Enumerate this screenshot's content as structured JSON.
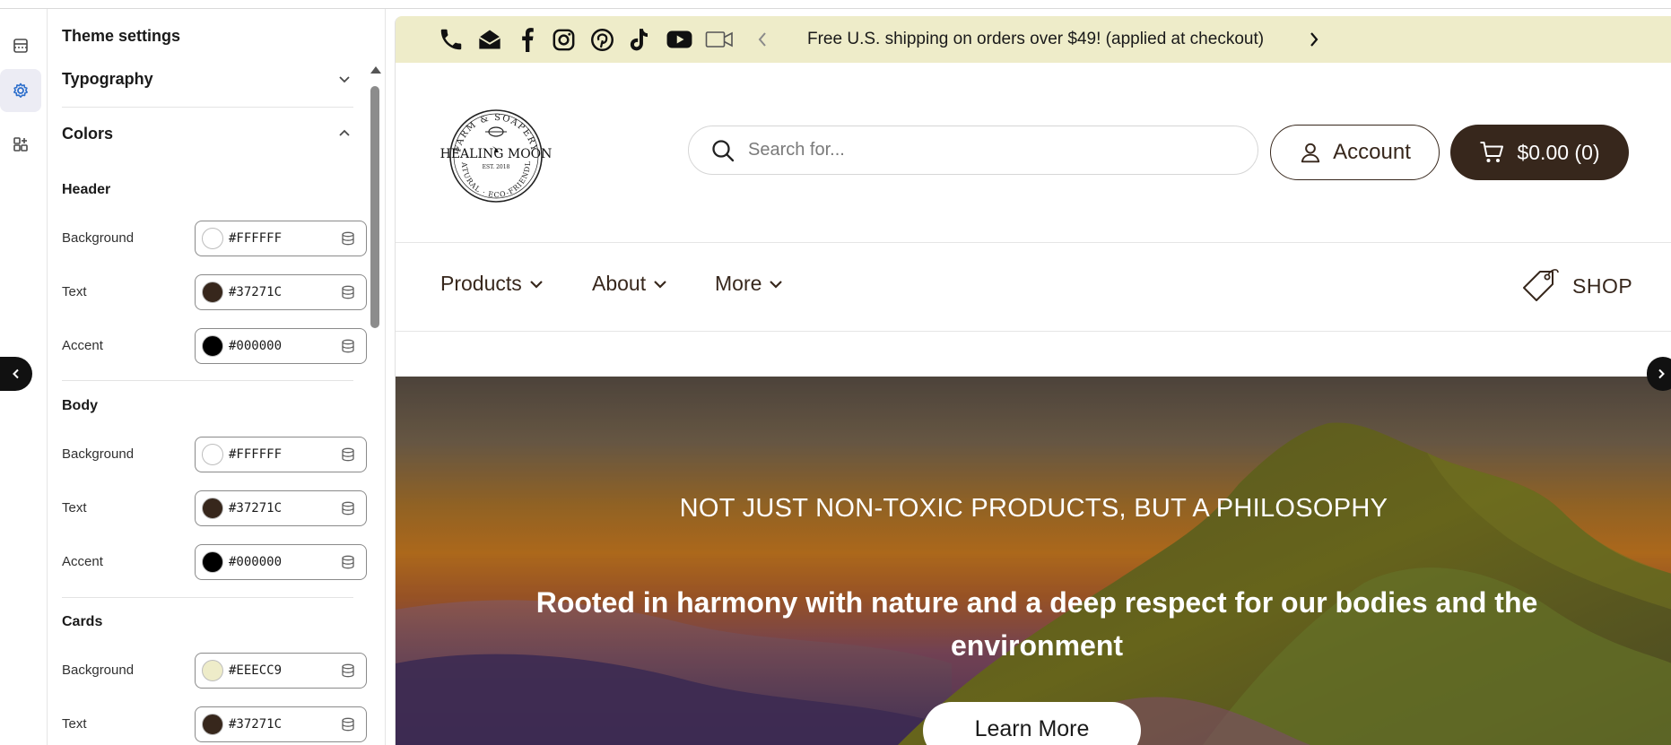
{
  "rail": {
    "icons": [
      "sections-icon",
      "theme-settings-icon",
      "app-blocks-icon"
    ]
  },
  "panel": {
    "title": "Theme settings",
    "typography_label": "Typography",
    "colors_label": "Colors",
    "groups": [
      {
        "label": "Header",
        "fields": [
          {
            "label": "Background",
            "hex": "#FFFFFF",
            "color": "#FFFFFF"
          },
          {
            "label": "Text",
            "hex": "#37271C",
            "color": "#37271C"
          },
          {
            "label": "Accent",
            "hex": "#000000",
            "color": "#000000"
          }
        ]
      },
      {
        "label": "Body",
        "fields": [
          {
            "label": "Background",
            "hex": "#FFFFFF",
            "color": "#FFFFFF"
          },
          {
            "label": "Text",
            "hex": "#37271C",
            "color": "#37271C"
          },
          {
            "label": "Accent",
            "hex": "#000000",
            "color": "#000000"
          }
        ]
      },
      {
        "label": "Cards",
        "fields": [
          {
            "label": "Background",
            "hex": "#EEECC9",
            "color": "#EEECC9"
          },
          {
            "label": "Text",
            "hex": "#37271C",
            "color": "#37271C"
          }
        ]
      }
    ]
  },
  "preview": {
    "announcement": {
      "social_icons": [
        "phone-icon",
        "email-icon",
        "facebook-icon",
        "instagram-icon",
        "pinterest-icon",
        "tiktok-icon",
        "youtube-icon",
        "video-icon"
      ],
      "text": "Free U.S. shipping on orders over $49! (applied at checkout)"
    },
    "header": {
      "logo_text": {
        "top": "FARM & SOAPERY",
        "center": "HEALING MOON",
        "est": "EST. 2018",
        "bottom": "NATURAL · ECO-FRIENDLY"
      },
      "search_placeholder": "Search for...",
      "account_label": "Account",
      "cart_label": "$0.00 (0)"
    },
    "nav": {
      "items": [
        "Products",
        "About",
        "More"
      ],
      "shop_label": "SHOP"
    },
    "hero": {
      "kicker": "NOT JUST NON-TOXIC PRODUCTS, BUT A PHILOSOPHY",
      "heading": "Rooted in harmony with nature and a deep respect for our bodies and the environment",
      "button_label": "Learn More"
    }
  },
  "colors": {
    "brand_dark": "#37271C",
    "announcement_bg": "#EEECC9",
    "rail_active_bg": "#ECECF4",
    "rail_active_icon": "#2C6ECB"
  }
}
